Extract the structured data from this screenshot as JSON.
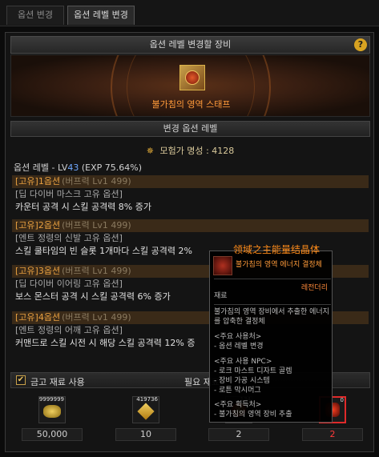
{
  "tabs": [
    {
      "label": "옵션 변경"
    },
    {
      "label": "옵션 레벨 변경"
    }
  ],
  "panel": {
    "title": "옵션 레벨 변경할 장비",
    "help": "?",
    "equipment_name": "불가침의 영역 스태프",
    "section_title": "변경 옵션 레벨"
  },
  "fame": {
    "label": "모험가 명성",
    "value": "4128"
  },
  "option_level": {
    "prefix": "옵션 레벨 - LV",
    "level": "43",
    "exp": "(EXP 75.64%)"
  },
  "options": [
    {
      "title": "[고유]1옵션",
      "sub": "(버프력 Lv1 499)",
      "line1": "[딥 다이버 마스크 고유 옵션]",
      "line2": "카운터 공격 시 스킬 공격력 8% 증가"
    },
    {
      "title": "[고유]2옵션",
      "sub": "(버프력 Lv1 499)",
      "line1": "[엔트 정령의 신발 고유 옵션]",
      "line2": "스킬 쿨타임의 빈 슬롯 1개마다 스킬 공격력 2%"
    },
    {
      "title": "[고유]3옵션",
      "sub": "(버프력 Lv1 499)",
      "line1": "[딥 다이버 이어링 고유 옵션]",
      "line2": "보스 몬스터 공격 시 스킬 공격력 6% 증가"
    },
    {
      "title": "[고유]4옵션",
      "sub": "(버프력 Lv1 499)",
      "line1": "[엔트 정령의 어깨 고유 옵션]",
      "line2": "커맨드로 스킬 시전 시 해당 스킬 공격력 12% 증"
    }
  ],
  "annotation": "领域之主能量结晶体",
  "tooltip": {
    "name": "불가침의 영역 에너지 결정체",
    "rarity": "레전더리",
    "category": "재료",
    "desc1": "불가침의 영역 장비에서 추출한 에너지",
    "desc2": "를 압축한 결정체",
    "usage_title": "<주요 사용처>",
    "usage_1": "- 옵션 레벨 변경",
    "npc_title": "<주요 사용 NPC>",
    "npc_1": "- 로크 마스트 디자트 골렘",
    "npc_2": "- 장비 가공 시스템",
    "npc_3": "- 로튼 막시머그",
    "obtain_title": "<주요 획득처>",
    "obtain_1": "- 불가침의 영역 장비 추출"
  },
  "bottom": {
    "check_mark": "✔",
    "checkbox_label": "금고 재료 사용",
    "required_label": "필요 재료"
  },
  "materials": [
    {
      "count": "9999999",
      "quantity": "50,000"
    },
    {
      "count": "419736",
      "quantity": "10"
    },
    {
      "count": "134",
      "quantity": "2"
    },
    {
      "count": "0",
      "quantity": "2"
    }
  ]
}
